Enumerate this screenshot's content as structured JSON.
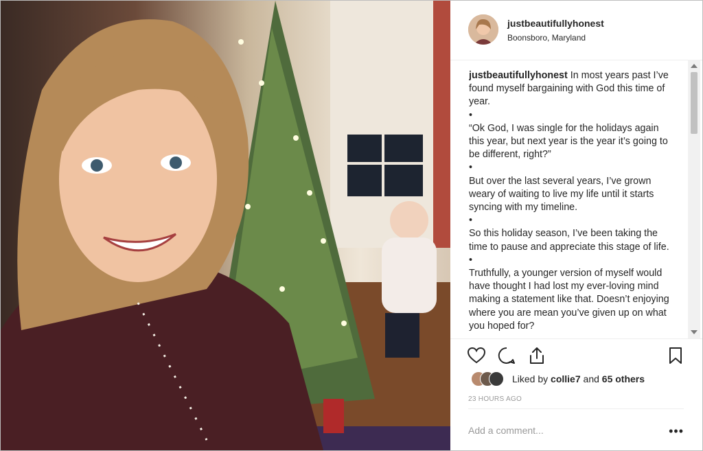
{
  "post": {
    "username": "justbeautifullyhonest",
    "location": "Boonsboro, Maryland",
    "caption_user": "justbeautifullyhonest",
    "caption_paragraphs": [
      "In most years past I’ve found myself bargaining with God this time of year.",
      "•",
      "“Ok God, I was single for the holidays again this year, but next year is the year it’s going to be different, right?”",
      "•",
      "But over the last several years, I’ve grown weary of waiting to live my life until it starts syncing with my timeline.",
      "•",
      "So this holiday season, I’ve been taking the time to pause and appreciate this stage of life.",
      "•",
      "Truthfully, a younger version of myself would have thought I had lost my ever-loving mind making a statement like that. Doesn’t enjoying where you are mean you’ve given up on what you hoped for?"
    ],
    "likes_prefix": "Liked by",
    "liked_by": "collie7",
    "likes_and": "and",
    "likes_others": "65 others",
    "timestamp": "23 HOURS AGO",
    "comment_placeholder": "Add a comment...",
    "more_options": "•••"
  },
  "icons": {
    "like": "heart-icon",
    "comment": "comment-icon",
    "share": "share-icon",
    "save": "bookmark-icon"
  },
  "colors": {
    "text": "#262626",
    "muted": "#999999",
    "divider": "#efefef"
  }
}
